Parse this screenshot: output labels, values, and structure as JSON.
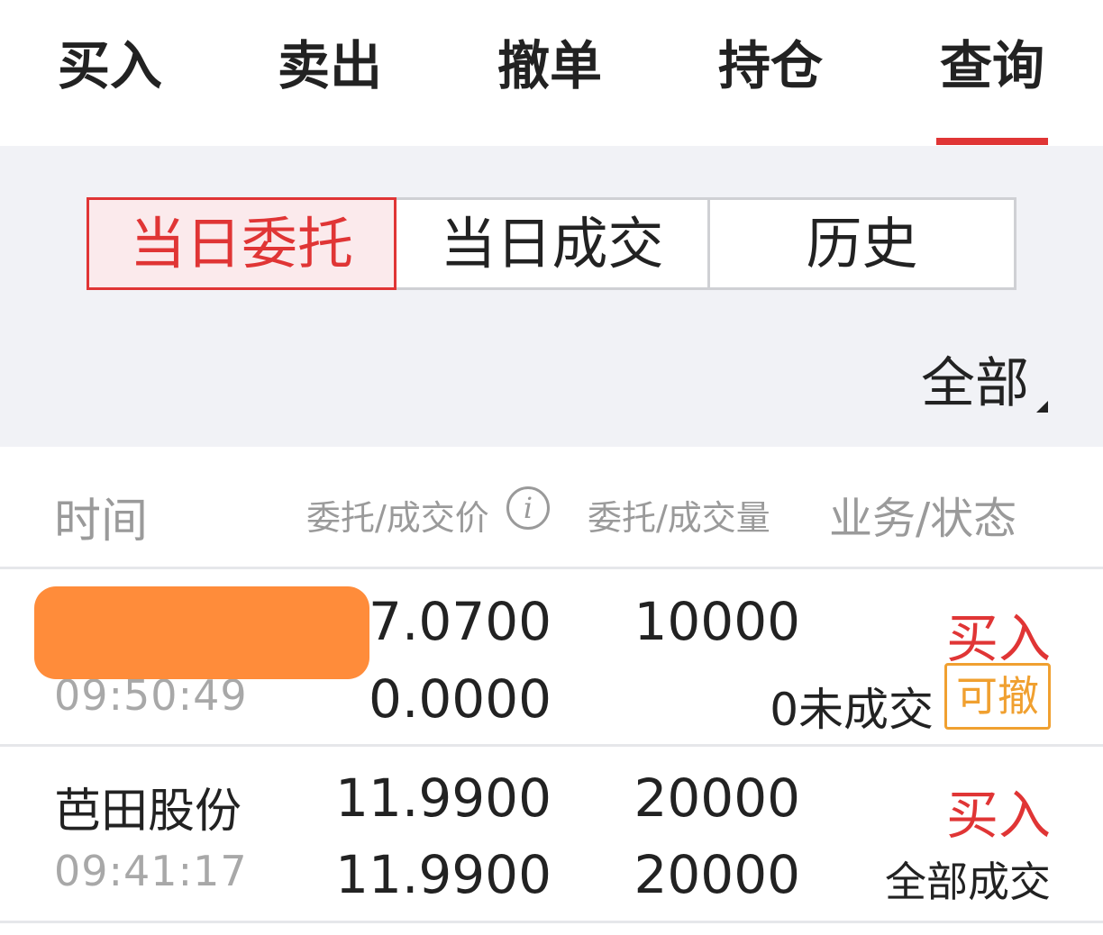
{
  "top_tabs": [
    {
      "label": "买入"
    },
    {
      "label": "卖出"
    },
    {
      "label": "撤单"
    },
    {
      "label": "持仓"
    },
    {
      "label": "查询",
      "active": true
    }
  ],
  "segments": [
    {
      "label": "当日委托",
      "active": true
    },
    {
      "label": "当日成交"
    },
    {
      "label": "历史"
    }
  ],
  "scope_filter": "全部",
  "columns": {
    "time": "时间",
    "price": "委托/成交价",
    "qty": "委托/成交量",
    "status": "业务/状态"
  },
  "orders": [
    {
      "name": "",
      "time": "09:50:49",
      "order_price": "7.0700",
      "fill_price": "0.0000",
      "order_qty": "10000",
      "status": "0未成交",
      "side": "买入",
      "cancel_label": "可撤"
    },
    {
      "name": "芭田股份",
      "time": "09:41:17",
      "order_price": "11.9900",
      "fill_price": "11.9900",
      "order_qty": "20000",
      "fill_qty": "20000",
      "status": "全部成交",
      "side": "买入"
    }
  ],
  "colors": {
    "accent_red": "#e03535",
    "cancel_orange": "#f0a030",
    "redaction_orange": "#ff8c3a",
    "panel_bg": "#f1f2f6"
  }
}
